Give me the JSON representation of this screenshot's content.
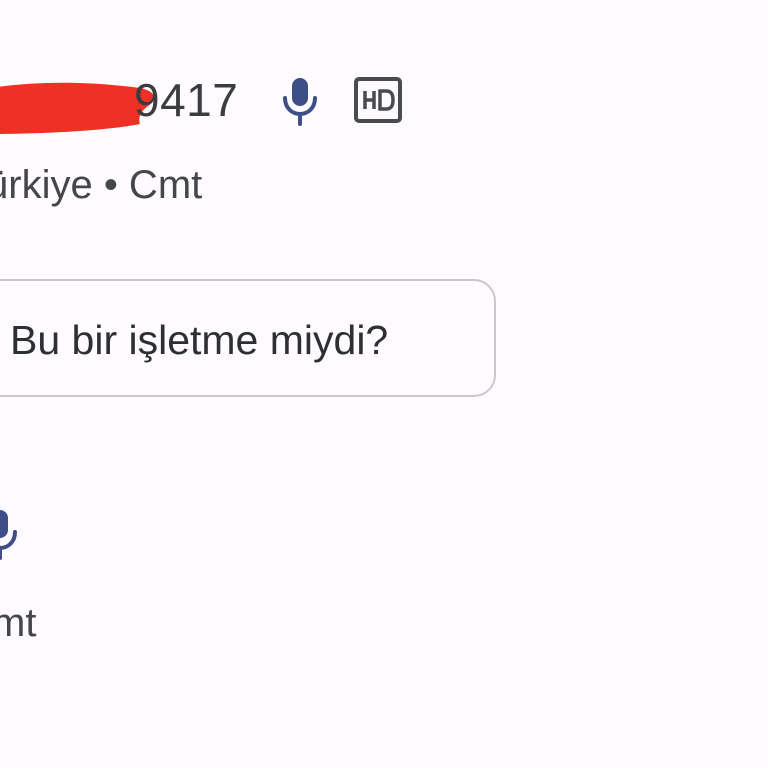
{
  "call_entry_1": {
    "number_suffix": "9417",
    "meta": "ürkiye • Cmt",
    "icons": [
      "microphone-icon",
      "hd-icon"
    ]
  },
  "business_prompt": {
    "label": "Bu bir işletme miydi?"
  },
  "call_entry_2": {
    "meta": "mt",
    "icons": [
      "microphone-icon"
    ]
  },
  "colors": {
    "background": "#fdfbfe",
    "redaction": "#ee3124",
    "icon_blue": "#3d4f86",
    "chip_border": "#c9c7cc",
    "text": "#3c3c40"
  }
}
